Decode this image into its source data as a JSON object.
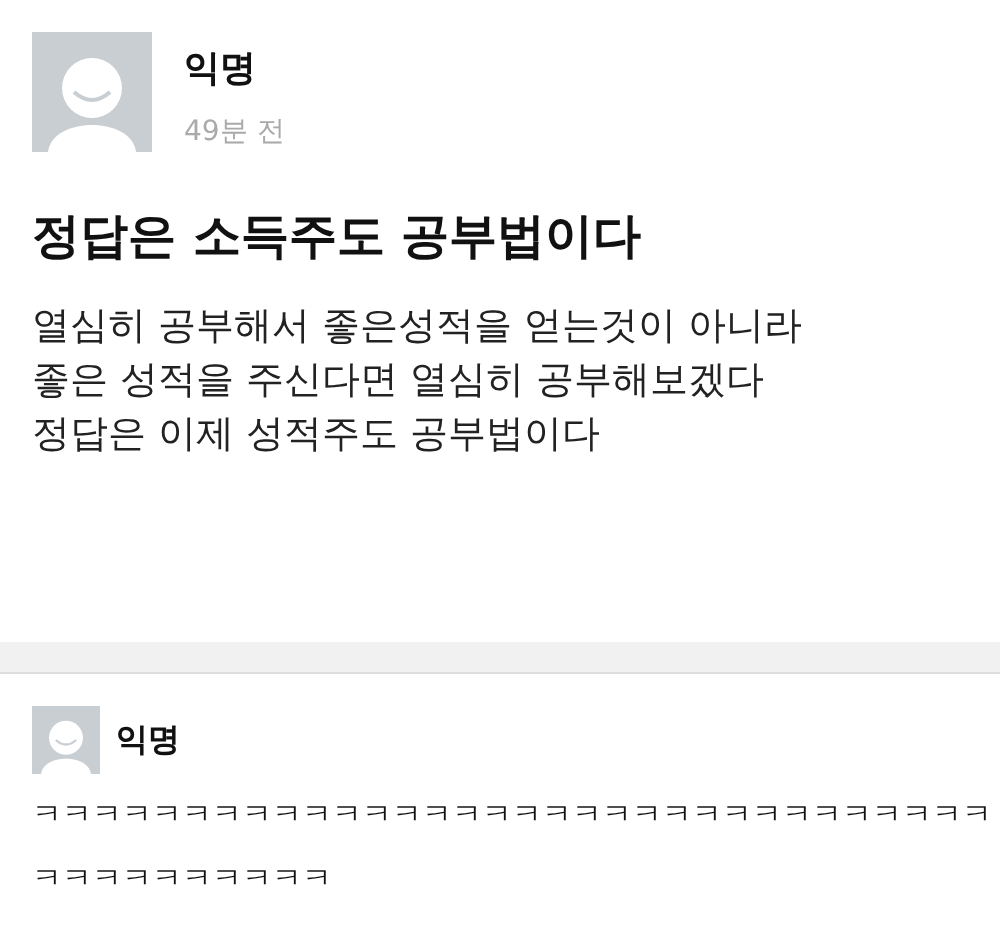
{
  "post": {
    "author": "익명",
    "time": "49분 전",
    "title": "정답은 소득주도 공부법이다",
    "body_lines": [
      "열심히 공부해서 좋은성적을 얻는것이 아니라",
      "좋은 성적을 주신다면 열심히 공부해보겠다",
      "정답은 이제 성적주도 공부법이다"
    ]
  },
  "comments": [
    {
      "author": "익명",
      "text": "ㅋㅋㅋㅋㅋㅋㅋㅋㅋㅋㅋㅋㅋㅋㅋㅋㅋㅋㅋㅋㅋㅋㅋㅋㅋㅋㅋㅋㅋㅋㅋㅋㅋㅋㅋㅋㅋㅋㅋㅋㅋㅋ"
    }
  ]
}
